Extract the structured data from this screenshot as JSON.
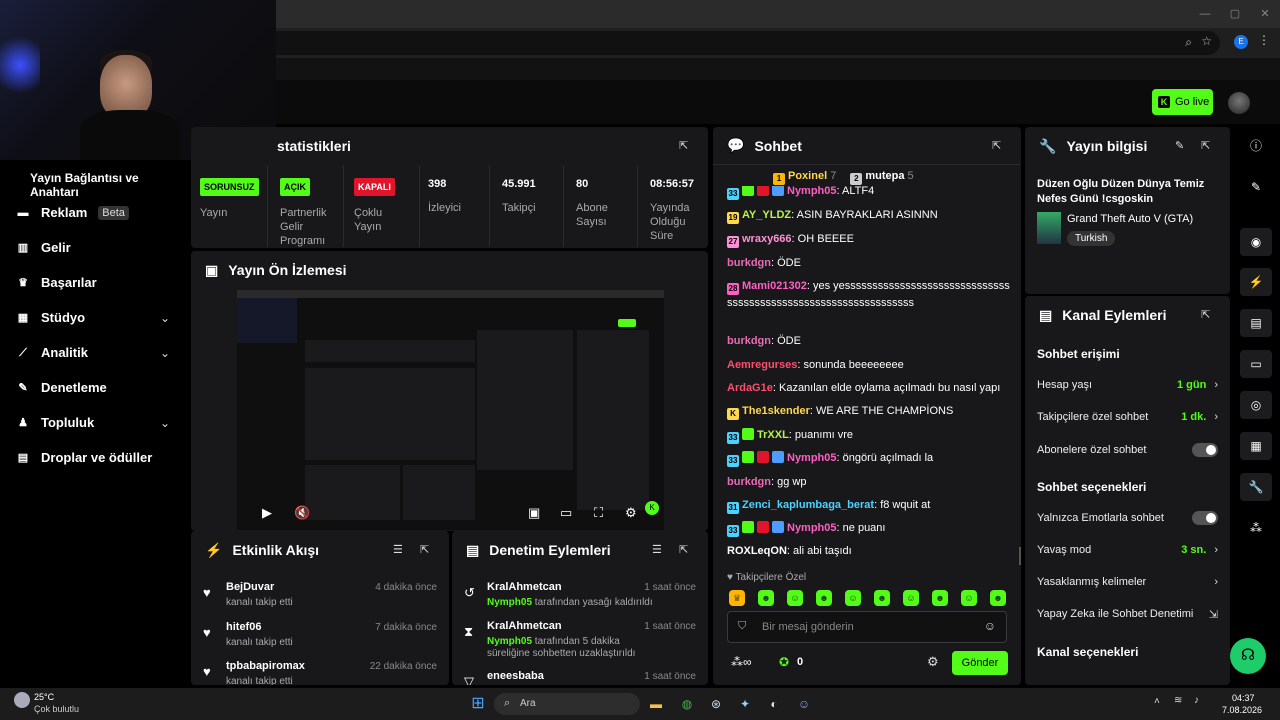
{
  "sidebar": {
    "title": "Yayın Bağlantısı ve Anahtarı",
    "items": [
      {
        "label": "Reklam",
        "badge": "Beta",
        "icon": "megaphone-icon"
      },
      {
        "label": "Gelir",
        "icon": "chart-icon"
      },
      {
        "label": "Başarılar",
        "icon": "trophy-icon"
      },
      {
        "label": "Stüdyo",
        "icon": "studio-icon"
      },
      {
        "label": "Analitik",
        "icon": "analytics-icon"
      },
      {
        "label": "Denetleme",
        "icon": "wrench-icon"
      },
      {
        "label": "Topluluk",
        "icon": "community-icon"
      },
      {
        "label": "Droplar ve ödüller",
        "icon": "drops-icon"
      }
    ]
  },
  "header": {
    "golive": "Go live"
  },
  "stats": {
    "title": "statistikleri",
    "cells": [
      {
        "badge": "SORUNSUZ",
        "label": "Yayın"
      },
      {
        "badge": "AÇIK",
        "label": "Partnerlik Gelir Programı"
      },
      {
        "badge": "KAPALI",
        "label": "Çoklu Yayın"
      },
      {
        "value": "398",
        "label": "İzleyici"
      },
      {
        "value": "45.991",
        "label": "Takipçi"
      },
      {
        "value": "80",
        "label": "Abone Sayısı"
      },
      {
        "value": "08:56:57",
        "label": "Yayında Olduğu Süre"
      }
    ]
  },
  "preview": {
    "title": "Yayın Ön İzlemesi"
  },
  "activity": {
    "title": "Etkinlik Akışı",
    "items": [
      {
        "name": "BejDuvar",
        "sub": "kanalı takip etti",
        "time": "4 dakika önce"
      },
      {
        "name": "hitef06",
        "sub": "kanalı takip etti",
        "time": "7 dakika önce"
      },
      {
        "name": "tpbabapiromax",
        "sub": "kanalı takip etti",
        "time": "22 dakika önce"
      }
    ]
  },
  "moderation": {
    "title": "Denetim Eylemleri",
    "items": [
      {
        "name": "KralAhmetcan",
        "mod": "Nymph05",
        "sub": " tarafından yasağı kaldırıldı",
        "time": "1 saat önce"
      },
      {
        "name": "KralAhmetcan",
        "mod": "Nymph05",
        "sub": " tarafından 5 dakika süreliğine sohbetten uzaklaştırıldı",
        "time": "1 saat önce"
      },
      {
        "name": "eneesbaba",
        "mod": "",
        "sub": "",
        "time": "1 saat önce"
      }
    ]
  },
  "chat": {
    "title": "Sohbet",
    "top": [
      {
        "rank": "1",
        "name": "Poxinel",
        "count": "7"
      },
      {
        "rank": "2",
        "name": "mutepa",
        "count": "5"
      }
    ],
    "messages": [
      {
        "user": "Nymph05",
        "text": "ALTF4",
        "color": "#ff5ec4"
      },
      {
        "user": "AY_YLDZ",
        "text": "ASIN BAYRAKLARI ASINNN",
        "color": "#b7f34b"
      },
      {
        "user": "wraxy666",
        "text": "OH BEEEE",
        "color": "#ff8fd8"
      },
      {
        "user": "burkdgn",
        "text": "ÖDE",
        "color": "#e96bb3"
      },
      {
        "user": "Mami021302",
        "text": "yes yessssssssssssssssssssssssssssssssssssssssssssssssssssssssssssssss",
        "color": "#ff5ec4"
      },
      {
        "user": "burkdgn",
        "text": "ÖDE",
        "color": "#e96bb3"
      },
      {
        "user": "Aemregurses",
        "text": "sonunda beeeeeeee",
        "color": "#ff4d6d"
      },
      {
        "user": "ArdaG1e",
        "text": "Kazanılan elde oylama açılmadı bu nasıl yapı",
        "color": "#ff4d6d"
      },
      {
        "user": "The1skender",
        "text": "WE ARE THE CHAMPİONS",
        "color": "#ffd84d"
      },
      {
        "user": "TrXXL",
        "text": "puanımı vre",
        "color": "#b7f34b"
      },
      {
        "user": "Nymph05",
        "text": "öngörü açılmadı la",
        "color": "#ff5ec4"
      },
      {
        "user": "burkdgn",
        "text": "gg wp",
        "color": "#e96bb3"
      },
      {
        "user": "Zenci_kaplumbaga_berat",
        "text": "f8 wquit at",
        "color": "#4dd2ff"
      },
      {
        "user": "Nymph05",
        "text": "ne puanı",
        "color": "#ff5ec4"
      },
      {
        "user": "ROXLeqON",
        "text": "ali abi taşıdı",
        "color": "#ffffff"
      }
    ],
    "followers_only": "Takipçilere Özel",
    "placeholder": "Bir mesaj gönderin",
    "points": "0",
    "send": "Gönder"
  },
  "info": {
    "title": "Yayın bilgisi",
    "stream_title": "Düzen Oğlu Düzen Dünya Temiz Nefes Günü !csgoskin",
    "game": "Grand Theft Auto V (GTA)",
    "tag": "Turkish"
  },
  "channel": {
    "title": "Kanal Eylemleri",
    "chat_access": "Sohbet erişimi",
    "rows1": [
      {
        "label": "Hesap yaşı",
        "value": "1 gün"
      },
      {
        "label": "Takipçilere özel sohbet",
        "value": "1 dk."
      },
      {
        "label": "Abonelere özel sohbet",
        "value": ""
      }
    ],
    "chat_options": "Sohbet seçenekleri",
    "rows2": [
      {
        "label": "Yalnızca Emotlarla sohbet",
        "value": ""
      },
      {
        "label": "Yavaş mod",
        "value": "3 sn."
      },
      {
        "label": "Yasaklanmış kelimeler",
        "value": ""
      },
      {
        "label": "Yapay Zeka ile Sohbet Denetimi",
        "value": ""
      }
    ],
    "channel_options": "Kanal seçenekleri"
  },
  "taskbar": {
    "temp": "25°C",
    "weather": "Çok bulutlu",
    "search": "Ara",
    "time": "04:37",
    "date": "7.08.2026"
  }
}
